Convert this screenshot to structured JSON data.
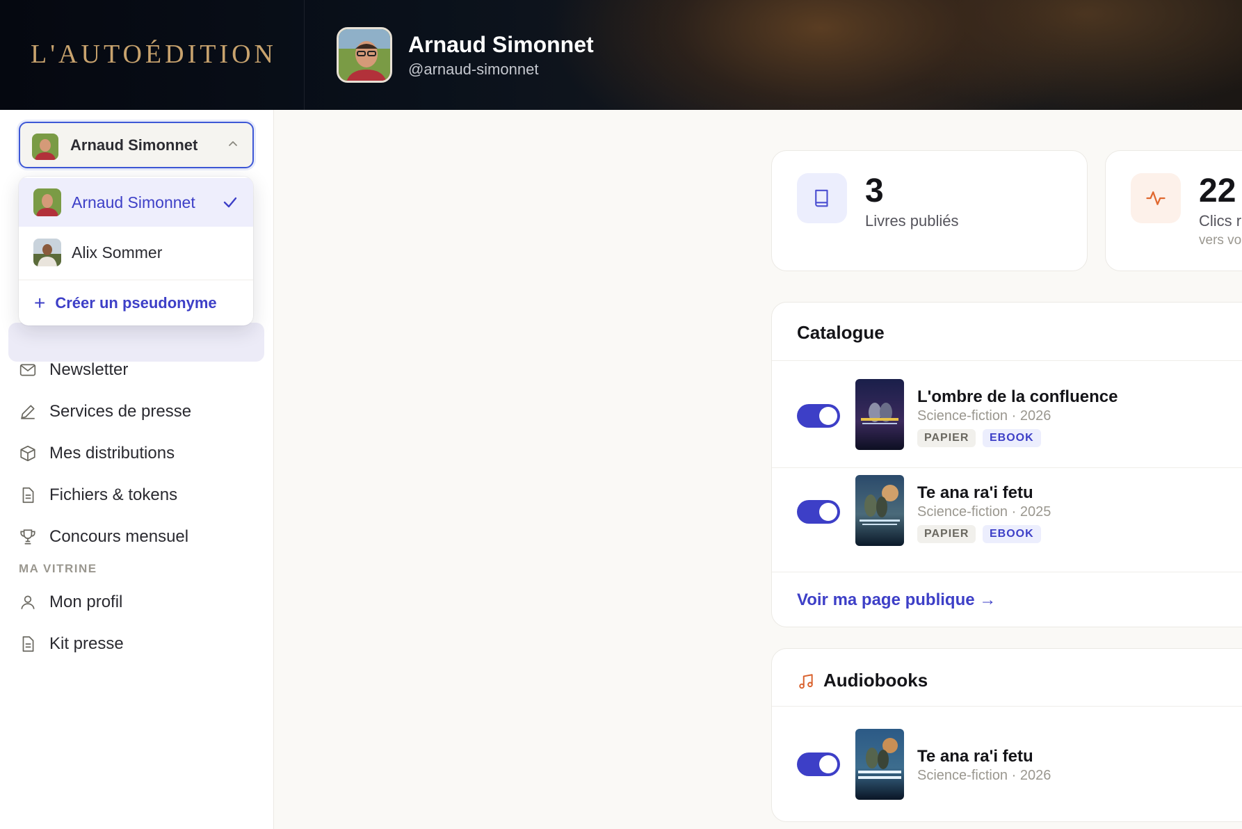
{
  "brand": {
    "logo": "L'AUTOÉDITION"
  },
  "profile_header": {
    "name": "Arnaud Simonnet",
    "handle": "@arnaud-simonnet"
  },
  "switcher": {
    "current": "Arnaud Simonnet"
  },
  "dropdown": {
    "items": [
      {
        "name": "Arnaud Simonnet",
        "selected": true
      },
      {
        "name": "Alix Sommer",
        "selected": false
      }
    ],
    "create_label": "Créer un pseudonyme"
  },
  "sidebar": {
    "items": [
      {
        "label": "Newsletter",
        "icon": "mail-icon"
      },
      {
        "label": "Services de presse",
        "icon": "pen-icon"
      },
      {
        "label": "Mes distributions",
        "icon": "box-icon"
      },
      {
        "label": "Fichiers & tokens",
        "icon": "file-icon"
      },
      {
        "label": "Concours mensuel",
        "icon": "trophy-icon"
      }
    ],
    "section_vitrine": "MA VITRINE",
    "vitrine_items": [
      {
        "label": "Mon profil",
        "icon": "user-icon"
      },
      {
        "label": "Kit presse",
        "icon": "file-icon"
      }
    ]
  },
  "stats": [
    {
      "value": "3",
      "label": "Livres publiés",
      "sub": "",
      "icon": "book-icon",
      "accent": "#4b4fd1"
    },
    {
      "value": "22",
      "label": "Clics r",
      "sub": "vers vo",
      "icon": "activity-icon",
      "accent": "#e0682f"
    }
  ],
  "catalogue": {
    "title": "Catalogue",
    "books": [
      {
        "title": "L'ombre de la confluence",
        "meta": "Science-fiction · 2026",
        "tags": [
          "PAPIER",
          "EBOOK"
        ],
        "enabled": true
      },
      {
        "title": "Te ana ra'i fetu",
        "meta": "Science-fiction · 2025",
        "tags": [
          "PAPIER",
          "EBOOK"
        ],
        "enabled": true
      }
    ],
    "public_link": "Voir ma page publique →"
  },
  "audiobooks": {
    "title": "Audiobooks",
    "items": [
      {
        "title": "Te ana ra'i fetu",
        "meta": "Science-fiction · 2026",
        "enabled": true
      }
    ]
  },
  "colors": {
    "accent": "#3d3fc7",
    "gold": "#c8a36e"
  }
}
